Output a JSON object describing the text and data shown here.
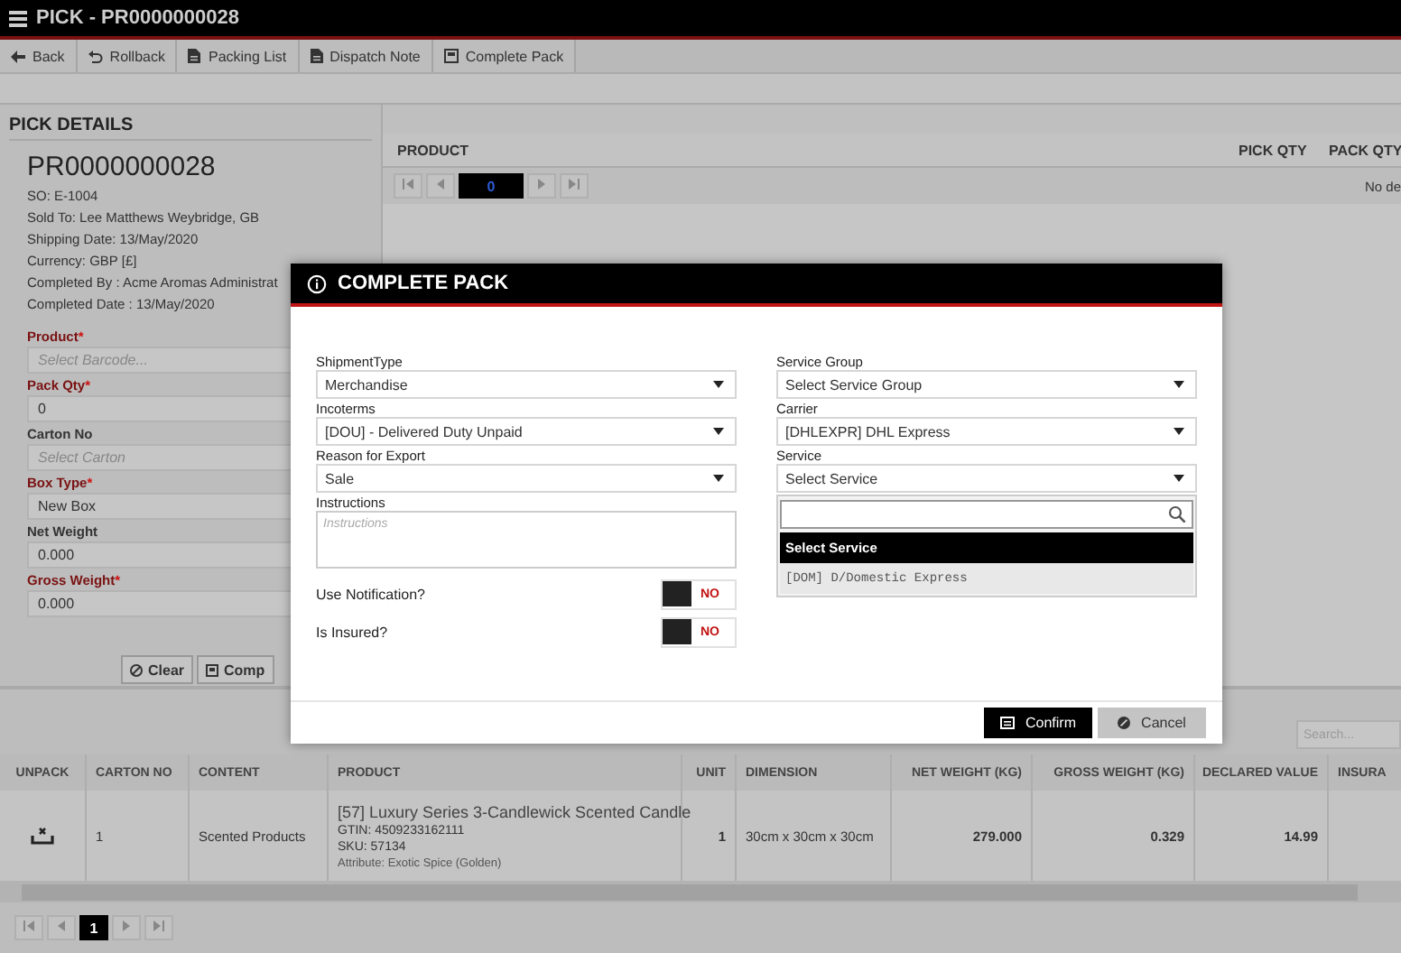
{
  "window": {
    "title": "PICK - PR0000000028"
  },
  "toolbar": [
    {
      "label": "Back",
      "kind": "back"
    },
    {
      "label": "Rollback",
      "kind": "undo"
    },
    {
      "label": "Packing List",
      "kind": "doc"
    },
    {
      "label": "Dispatch Note",
      "kind": "doc"
    },
    {
      "label": "Complete Pack",
      "kind": "pack"
    }
  ],
  "pick_details": {
    "heading": "PICK DETAILS",
    "number": "PR0000000028",
    "info": [
      "SO: E-1004",
      "Sold To: Lee Matthews Weybridge, GB",
      "Shipping Date: 13/May/2020",
      "Currency: GBP [£]",
      "Completed By : Acme Aromas Administrat",
      "Completed Date : 13/May/2020"
    ],
    "fields": [
      {
        "label": "Product",
        "required": true,
        "mark": "*",
        "placeholder": "Select Barcode..."
      },
      {
        "label": "Pack Qty",
        "required": true,
        "mark": "*",
        "value": "0"
      },
      {
        "label": "Carton No",
        "required": false,
        "placeholder": "Select Carton"
      },
      {
        "label": "Box Type",
        "required": true,
        "mark": "*",
        "value": "New Box"
      },
      {
        "label": "Net Weight",
        "required": false,
        "value": "0.000"
      },
      {
        "label": "Gross Weight",
        "required": true,
        "mark": "*",
        "value": "0.000"
      }
    ],
    "buttons": [
      {
        "label": "Clear",
        "kind": "clear"
      },
      {
        "label": "Comp",
        "kind": "pack"
      }
    ]
  },
  "product_panel": {
    "columns": [
      "PRODUCT",
      "PICK QTY",
      "PACK QTY"
    ],
    "page": "0",
    "empty_text": "No de"
  },
  "modal": {
    "title": "COMPLETE PACK",
    "left_fields": [
      {
        "label": "ShipmentType",
        "value": "Merchandise"
      },
      {
        "label": "Incoterms",
        "value": "[DOU] - Delivered Duty Unpaid"
      },
      {
        "label": "Reason for Export",
        "value": "Sale"
      }
    ],
    "instructions": {
      "label": "Instructions",
      "placeholder": "Instructions"
    },
    "toggles": [
      {
        "label": "Use Notification?",
        "on": false,
        "state_text": "NO"
      },
      {
        "label": "Is Insured?",
        "on": false,
        "state_text": "NO"
      }
    ],
    "right_fields": [
      {
        "label": "Service Group",
        "value": "Select Service Group"
      },
      {
        "label": "Carrier",
        "value": "[DHLEXPR] DHL Express"
      },
      {
        "label": "Service",
        "value": "Select Service"
      }
    ],
    "service_dropdown": {
      "options": [
        {
          "label": "Select Service",
          "selected": true
        },
        {
          "label": "[DOM] D/Domestic Express",
          "selected": false
        }
      ]
    },
    "buttons": [
      {
        "label": "Confirm",
        "kind": "primary"
      },
      {
        "label": "Cancel",
        "kind": "secondary"
      }
    ]
  },
  "cartons": {
    "search": {
      "placeholder": "Search..."
    },
    "columns": [
      "UNPACK",
      "CARTON NO",
      "CONTENT",
      "PRODUCT",
      "UNIT",
      "DIMENSION",
      "NET WEIGHT (KG)",
      "GROSS WEIGHT (KG)",
      "DECLARED VALUE",
      "INSURA"
    ],
    "rows": [
      {
        "carton_no": "1",
        "content": "Scented Products",
        "product": "[57] Luxury Series 3-Candlewick Scented Candle",
        "gtin": "GTIN: 4509233162111",
        "sku": "SKU: 57134",
        "attribute": "Attribute: Exotic Spice (Golden)",
        "unit": "1",
        "dimension": "30cm x 30cm x 30cm",
        "net_weight": "279.000",
        "gross_weight": "0.329",
        "declared_value": "14.99"
      }
    ],
    "page": "1"
  }
}
